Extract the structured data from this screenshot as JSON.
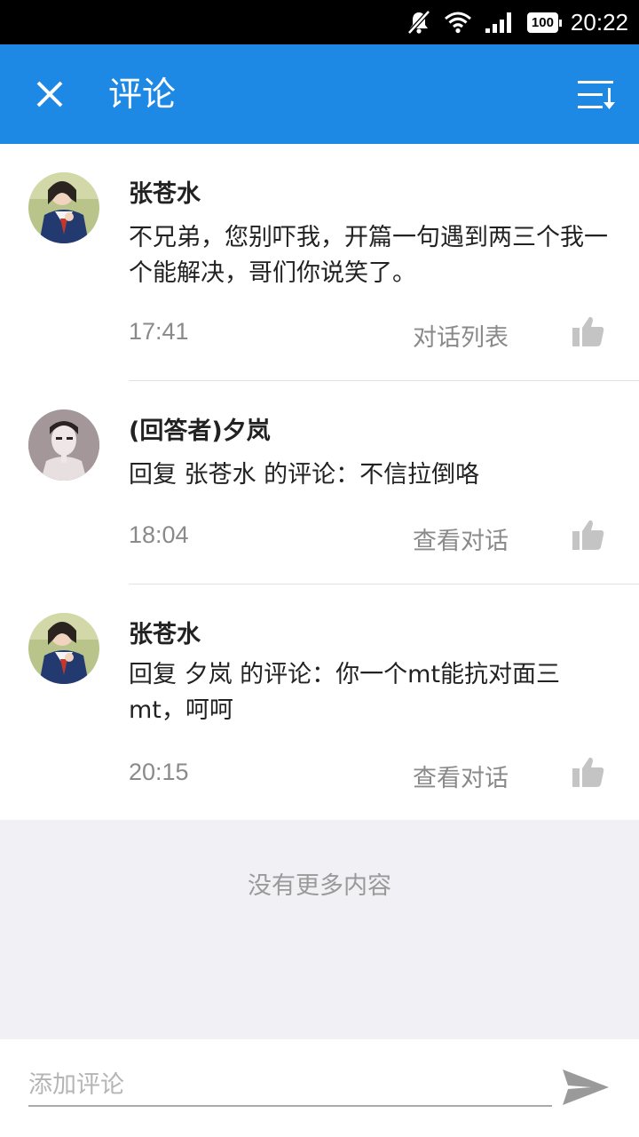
{
  "status_bar": {
    "time": "20:22",
    "battery": "100",
    "icons": [
      "notifications-off-icon",
      "wifi-icon",
      "signal-icon",
      "battery-icon"
    ]
  },
  "app_bar": {
    "title": "评论",
    "left_icon": "close-icon",
    "right_icon": "sort-icon",
    "background": "#1e88e5"
  },
  "comments": [
    {
      "author": "张苍水",
      "text": "不兄弟，您别吓我，开篇一句遇到两三个我一个能解决，哥们你说笑了。",
      "time": "17:41",
      "action": "对话列表"
    },
    {
      "author": "(回答者)夕岚",
      "text": "回复 张苍水 的评论：不信拉倒咯",
      "time": "18:04",
      "action": "查看对话"
    },
    {
      "author": "张苍水",
      "text": "回复 夕岚 的评论：你一个mt能抗对面三mt，呵呵",
      "time": "20:15",
      "action": "查看对话"
    }
  ],
  "end_message": "没有更多内容",
  "input": {
    "placeholder": "添加评论",
    "send_icon": "send-icon"
  }
}
